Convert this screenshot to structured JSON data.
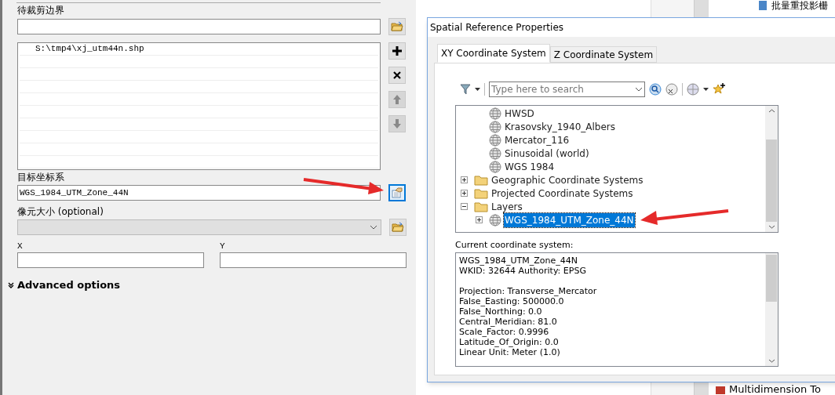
{
  "tool_form": {
    "clip_label": "待裁剪边界",
    "list_items": [
      {
        "text": "S:\\tmp4\\xj_utm44n.shp"
      }
    ],
    "target_label": "目标坐标系",
    "target_value": "WGS_1984_UTM_Zone_44N",
    "cell_size_label": "像元大小 (optional)",
    "x_label": "X",
    "y_label": "Y",
    "advanced": {
      "label": "Advanced options",
      "expanded": false
    }
  },
  "background": {
    "top_item": "批量重投影栅",
    "bottom_item": "Multidimension To"
  },
  "dialog": {
    "title": "Spatial Reference Properties",
    "tabs": [
      {
        "label": "XY Coordinate System",
        "selected": true
      },
      {
        "label": "Z Coordinate System",
        "selected": false
      }
    ],
    "search": {
      "placeholder": "Type here to search"
    },
    "tree": {
      "partial_children": [
        {
          "label": "HWSD",
          "kind": "globe",
          "selected": false
        },
        {
          "label": "Krasovsky_1940_Albers",
          "kind": "globe",
          "selected": false
        },
        {
          "label": "Mercator_116",
          "kind": "globe",
          "selected": false
        },
        {
          "label": "Sinusoidal (world)",
          "kind": "globe",
          "selected": false
        },
        {
          "label": "WGS 1984",
          "kind": "globe",
          "selected": false
        }
      ],
      "items": [
        {
          "label": "Geographic Coordinate Systems",
          "kind": "folder",
          "expanded": false,
          "selected": false
        },
        {
          "label": "Projected Coordinate Systems",
          "kind": "folder",
          "expanded": false,
          "selected": false
        },
        {
          "label": "Layers",
          "kind": "folder",
          "expanded": true,
          "selected": false,
          "children": [
            {
              "label": "WGS_1984_UTM_Zone_44N",
              "kind": "globe",
              "expanded": false,
              "selected": true
            }
          ]
        }
      ]
    },
    "current_label": "Current coordinate system:",
    "current_blocks": [
      [
        "WGS_1984_UTM_Zone_44N",
        "WKID: 32644 Authority: EPSG"
      ],
      [
        "Projection: Transverse_Mercator",
        "False_Easting: 500000.0",
        "False_Northing: 0.0",
        "Central_Meridian: 81.0",
        "Scale_Factor: 0.9996",
        "Latitude_Of_Origin: 0.0",
        "Linear Unit: Meter (1.0)"
      ]
    ]
  }
}
